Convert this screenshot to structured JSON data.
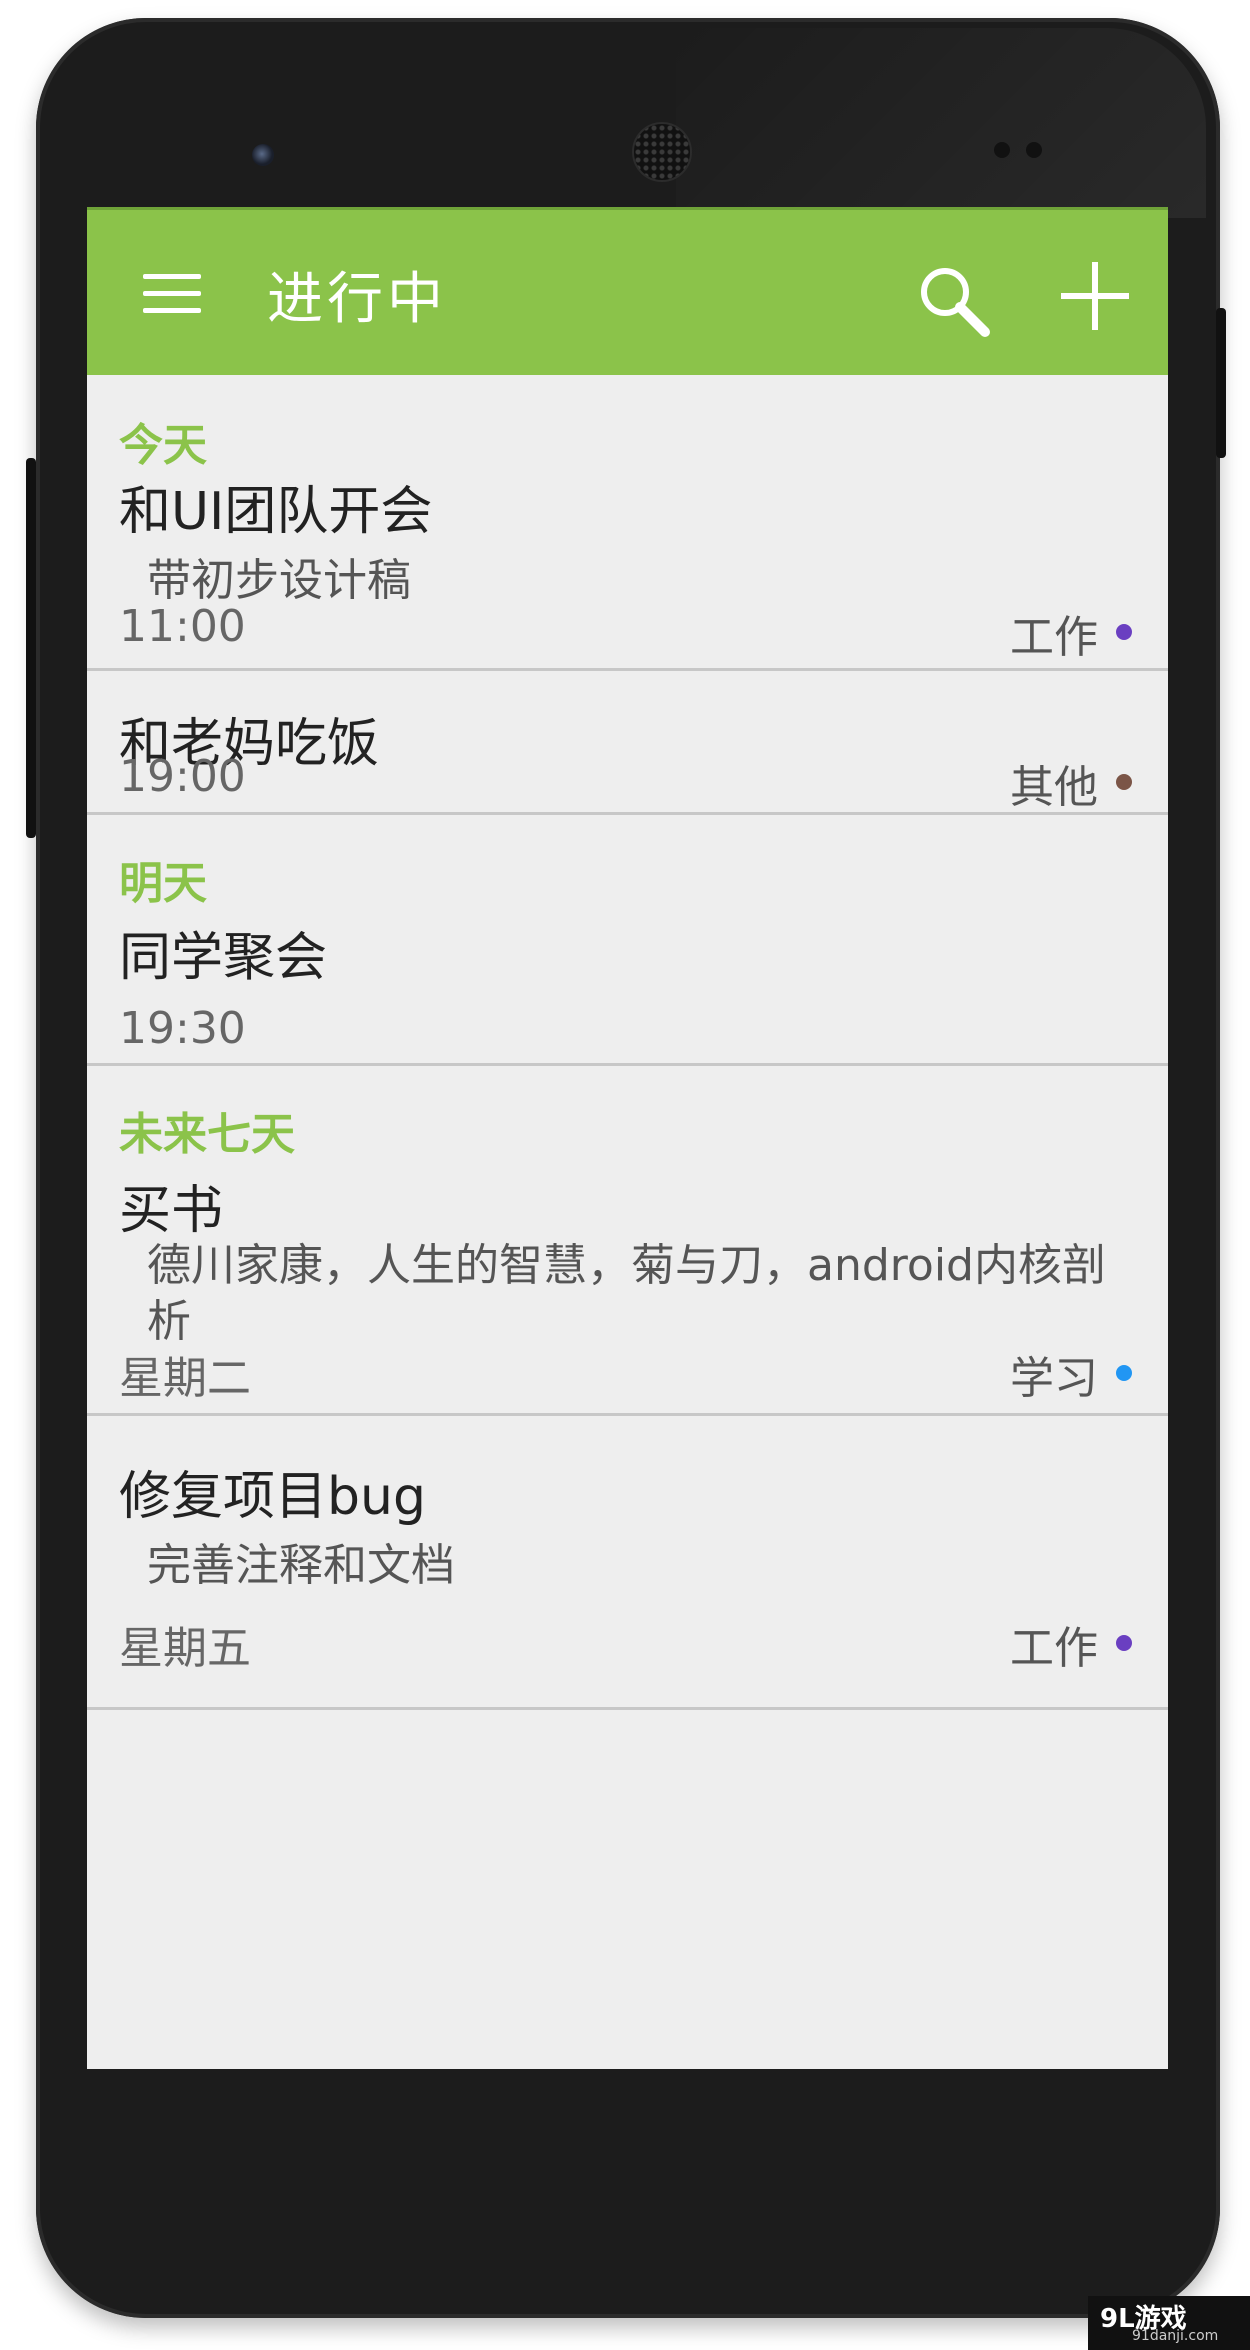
{
  "header": {
    "title": "进行中",
    "menu_icon": "menu-icon",
    "search_icon": "search-icon",
    "add_icon": "add-icon",
    "accent_color": "#8bc34a"
  },
  "sections": [
    {
      "header": "今天",
      "items": [
        {
          "title": "和UI团队开会",
          "note": "带初步设计稿",
          "time": "11:00",
          "tag": "工作",
          "tag_color": "#6a3fc1"
        },
        {
          "title": "和老妈吃饭",
          "note": "",
          "time": "19:00",
          "tag": "其他",
          "tag_color": "#7b5547"
        }
      ]
    },
    {
      "header": "明天",
      "items": [
        {
          "title": "同学聚会",
          "note": "",
          "time": "19:30",
          "tag": "",
          "tag_color": ""
        }
      ]
    },
    {
      "header": "未来七天",
      "items": [
        {
          "title": "买书",
          "note": "德川家康，人生的智慧，菊与刀，android内核剖析",
          "time": "星期二",
          "tag": "学习",
          "tag_color": "#2196f3"
        },
        {
          "title": "修复项目bug",
          "note": "完善注释和文档",
          "time": "星期五",
          "tag": "工作",
          "tag_color": "#6a3fc1"
        }
      ]
    }
  ],
  "watermark": {
    "text": "9L游戏",
    "sub": "91danji.com"
  }
}
